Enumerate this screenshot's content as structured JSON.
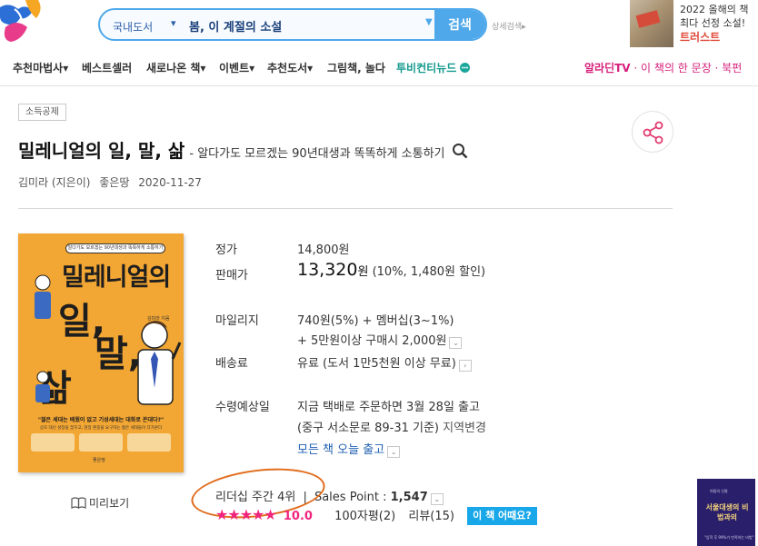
{
  "search": {
    "category": "국내도서",
    "query": "봄, 이 계절의 소설",
    "button_label": "검색",
    "advanced_label": "상세검색"
  },
  "promo": {
    "line1": "2022 올해의 책",
    "line2": "최다 선정 소설!",
    "line3": "트러스트"
  },
  "nav": {
    "items": [
      {
        "label": "추천마법사"
      },
      {
        "label": "베스트셀러"
      },
      {
        "label": "새로나온 책"
      },
      {
        "label": "이벤트"
      },
      {
        "label": "추천도서"
      },
      {
        "label": "그림책, 놀다"
      },
      {
        "label": "투비컨티뉴드"
      }
    ],
    "right_prefix": "알라딘TV",
    "right_text": "· 이 책의 한 문장 · 북펀"
  },
  "product": {
    "tag": "소득공제",
    "title": "밀레니얼의 일, 말, 삶",
    "subtitle": "- 알다가도 모르겠는 90년대생과 똑똑하게 소통하기",
    "author": "김미라 (지은이)",
    "publisher": "좋은땅",
    "date": "2020-11-27"
  },
  "cover": {
    "top_text": "알다가도 모르겠는 90년대생과 똑똑하게 소통하기",
    "title_line1": "밀레니얼의",
    "title_line2": "일,",
    "title_line3": "말,",
    "title_line4": "삶",
    "author": "김미라 지음",
    "quote": "\"젊은 세대는 배웠이 없고 기성세대는 대화로 꼰대다?\"",
    "desc": "상호 대신 성장을 꿈꾸고, 현장 존중을 요구하는 젊은 세대들이 다가온다",
    "publisher": "좋은땅"
  },
  "preview_label": "미리보기",
  "price": {
    "list_label": "정가",
    "list_value": "14,800원",
    "sale_label": "판매가",
    "sale_value": "13,320",
    "sale_unit": "원",
    "sale_discount": "(10%, 1,480원 할인)",
    "mileage_label": "마일리지",
    "mileage_line1": "740원(5%) + 멤버십(3~1%)",
    "mileage_line2": "+ 5만원이상 구매시 2,000원",
    "shipping_label": "배송료",
    "shipping_value": "유료 (도서 1만5천원 이상 무료)",
    "arrival_label": "수령예상일",
    "arrival_line1": "지금 택배로 주문하면 3월 28일 출고",
    "arrival_line2": "(중구 서소문로 89-31 기준)",
    "arrival_change": "지역변경",
    "arrival_link": "모든 책 오늘 출고"
  },
  "leadership": {
    "label": "리더십 주간 4위",
    "separator": "|",
    "sp_label": "Sales Point :",
    "sp_value": "1,547"
  },
  "rating": {
    "stars": 5,
    "score": "10.0",
    "reviews": "100자평(2)",
    "review_count": "리뷰(15)",
    "how_label": "이 책 어때요?"
  },
  "side_book": {
    "small": "여름의 선물",
    "title": "서울대생의 비법과외",
    "bottom": "\"입학 후 99%가 만족하는 비법\""
  },
  "colors": {
    "accent": "#4ea8ea",
    "star": "#f0257d",
    "cover": "#f2a633",
    "highlight_ellipse": "#e26c1c"
  }
}
